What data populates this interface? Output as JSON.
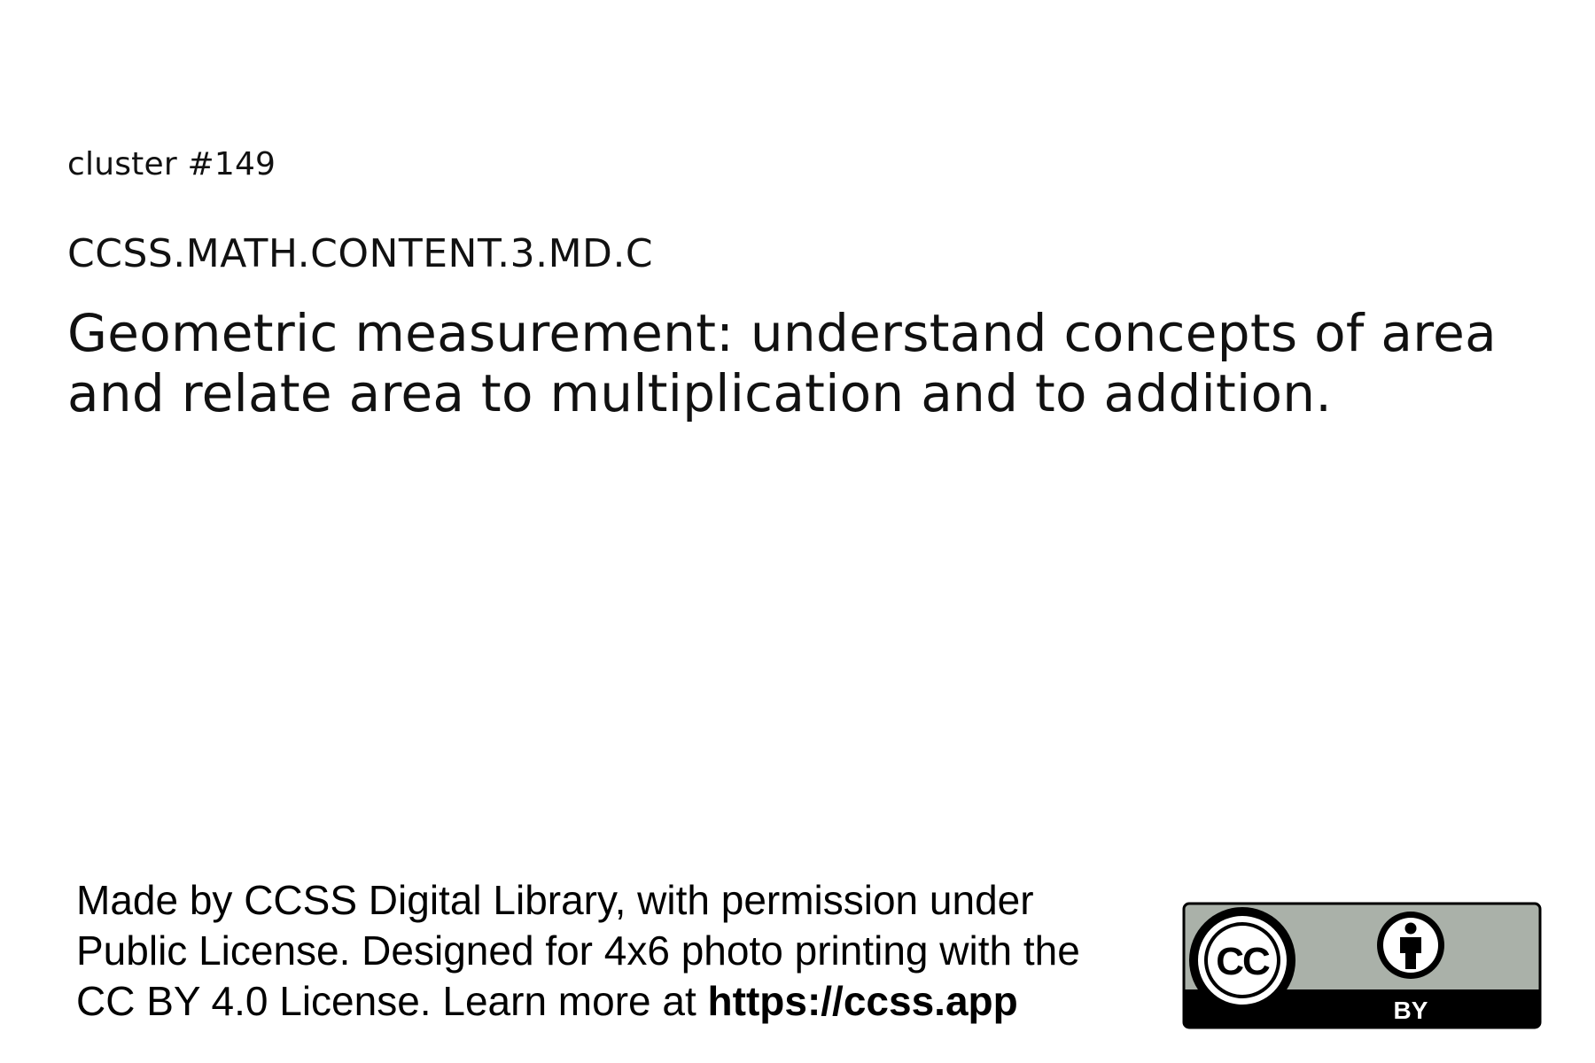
{
  "cluster": {
    "label": "cluster #149"
  },
  "standard": {
    "code": "CCSS.MATH.CONTENT.3.MD.C",
    "title": "Geometric measurement: understand concepts of area and relate area to multiplication and to addition."
  },
  "footer": {
    "attribution_line1": "Made by CCSS Digital Library, with permission under",
    "attribution_line2": "Public License. Designed for 4x6 photo printing with the",
    "attribution_line3_prefix": "CC BY 4.0 License. Learn more at ",
    "url": "https://ccss.app"
  },
  "license_badge": {
    "cc_text": "CC",
    "by_text": "BY",
    "icons": [
      "cc-icon",
      "attribution-person-icon"
    ],
    "colors": {
      "badge_background": "#aab1a9",
      "badge_border": "#000000",
      "by_strip": "#000000",
      "by_text": "#ffffff"
    }
  }
}
